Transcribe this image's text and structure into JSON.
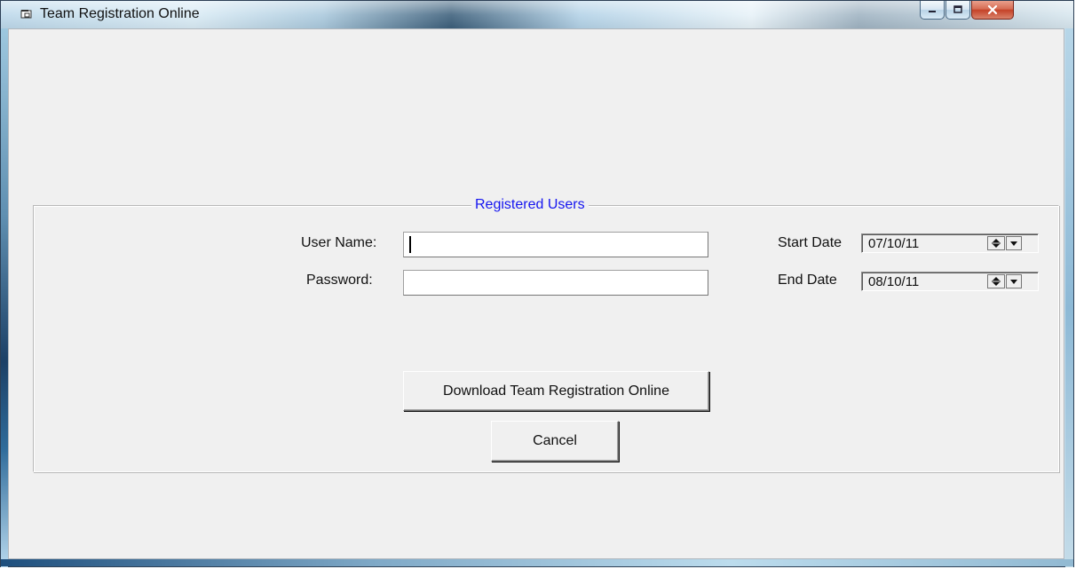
{
  "window": {
    "title": "Team Registration Online",
    "caption_buttons": {
      "minimize_icon": "minimize-icon",
      "maximize_icon": "maximize-icon",
      "close_icon": "close-icon"
    }
  },
  "group": {
    "title": "Registered Users",
    "title_color": "#1515f0"
  },
  "form": {
    "user_name_label": "User Name:",
    "user_name_value": "",
    "password_label": "Password:",
    "password_value": "",
    "start_date_label": "Start Date",
    "start_date_value": "07/10/11",
    "end_date_label": "End Date",
    "end_date_value": "08/10/11"
  },
  "buttons": {
    "download_label": "Download Team Registration Online",
    "cancel_label": "Cancel"
  },
  "icons": {
    "app_icon": "window-app-icon",
    "spinner_icon": "date-spinner-icon",
    "dropdown_icon": "chevron-down-icon"
  },
  "colors": {
    "window_surface": "#f0f0f0",
    "frame_blue": "#8dbad7",
    "close_red": "#c54329"
  }
}
